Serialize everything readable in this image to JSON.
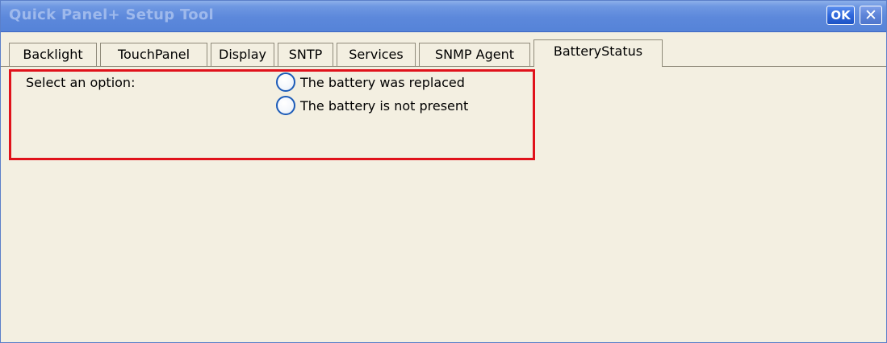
{
  "window": {
    "title": "Quick Panel+ Setup Tool",
    "ok_label": "OK",
    "close_label": "✕"
  },
  "tabs": [
    {
      "label": "Backlight",
      "active": false
    },
    {
      "label": "TouchPanel",
      "active": false
    },
    {
      "label": "Display",
      "active": false
    },
    {
      "label": "SNTP",
      "active": false
    },
    {
      "label": "Services",
      "active": false
    },
    {
      "label": "SNMP Agent",
      "active": false
    },
    {
      "label": "BatteryStatus",
      "active": true
    }
  ],
  "battery_status": {
    "prompt": "Select an option:",
    "options": [
      {
        "label": "The battery was replaced",
        "selected": false
      },
      {
        "label": "The battery is not present",
        "selected": false
      }
    ]
  },
  "colors": {
    "titlebar": "#5c88db",
    "window_background": "#f3efe1",
    "highlight_border": "#e0121b",
    "radio_border": "#1c5bb8"
  }
}
